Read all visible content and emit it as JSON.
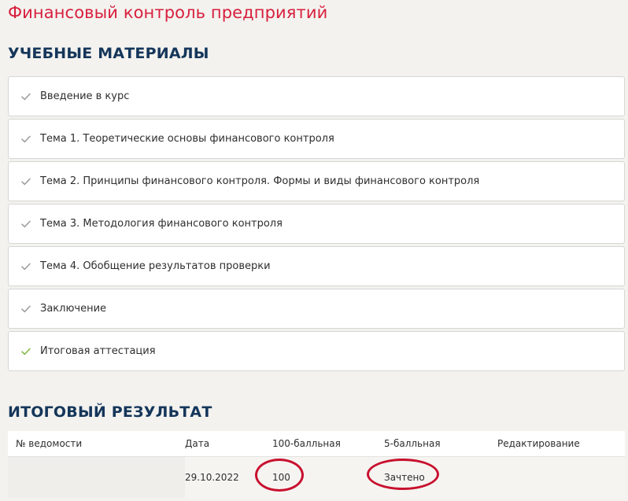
{
  "course": {
    "title": "Финансовый контроль предприятий"
  },
  "materials": {
    "heading": "УЧЕБНЫЕ МАТЕРИАЛЫ",
    "items": [
      {
        "label": "Введение в курс",
        "status": "viewed"
      },
      {
        "label": "Тема 1. Теоретические основы финансового контроля",
        "status": "viewed"
      },
      {
        "label": "Тема 2. Принципы финансового контроля. Формы и виды финансового контроля",
        "status": "viewed"
      },
      {
        "label": "Тема 3. Методология финансового контроля",
        "status": "viewed"
      },
      {
        "label": "Тема 4. Обобщение результатов проверки",
        "status": "viewed"
      },
      {
        "label": "Заключение",
        "status": "viewed"
      },
      {
        "label": "Итоговая аттестация",
        "status": "passed"
      }
    ]
  },
  "result": {
    "heading": "ИТОГОВЫЙ РЕЗУЛЬТАТ",
    "columns": [
      "№ ведомости",
      "Дата",
      "100-балльная",
      "5-балльная",
      "Редактирование"
    ],
    "rows": [
      {
        "number": "",
        "date": "29.10.2022",
        "score100": "100",
        "score5": "Зачтено",
        "edit": ""
      }
    ]
  },
  "colors": {
    "course_title": "#d81f3c",
    "section_heading": "#15365a",
    "check_viewed": "#9a9a9a",
    "check_passed": "#7fb742",
    "annotation_circle": "#c8102e"
  },
  "icons": {
    "check": "check-icon"
  }
}
